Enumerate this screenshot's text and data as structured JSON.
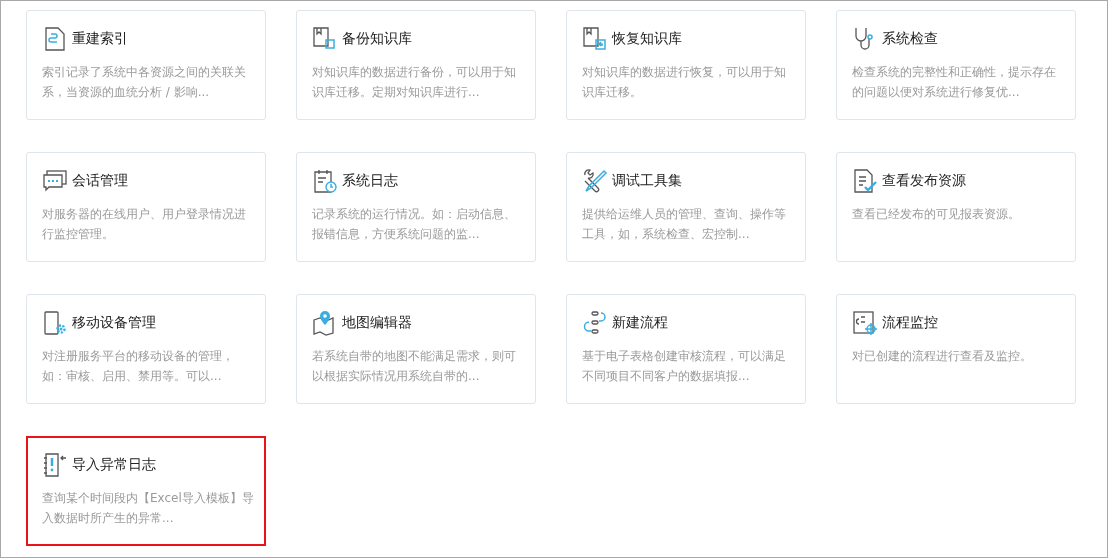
{
  "cards": [
    {
      "title": "重建索引",
      "description": "索引记录了系统中各资源之间的关联关系，当资源的血统分析 / 影响...",
      "selected": false
    },
    {
      "title": "备份知识库",
      "description": "对知识库的数据进行备份，可以用于知识库迁移。定期对知识库进行...",
      "selected": false
    },
    {
      "title": "恢复知识库",
      "description": "对知识库的数据进行恢复，可以用于知识库迁移。",
      "selected": false
    },
    {
      "title": "系统检查",
      "description": "检查系统的完整性和正确性，提示存在的问题以便对系统进行修复优...",
      "selected": false
    },
    {
      "title": "会话管理",
      "description": "对服务器的在线用户、用户登录情况进行监控管理。",
      "selected": false
    },
    {
      "title": "系统日志",
      "description": "记录系统的运行情况。如：启动信息、报错信息，方便系统问题的监...",
      "selected": false
    },
    {
      "title": "调试工具集",
      "description": "提供给运维人员的管理、查询、操作等工具，如，系统检查、宏控制...",
      "selected": false
    },
    {
      "title": "查看发布资源",
      "description": "查看已经发布的可见报表资源。",
      "selected": false
    },
    {
      "title": "移动设备管理",
      "description": "对注册服务平台的移动设备的管理，如：审核、启用、禁用等。可以...",
      "selected": false
    },
    {
      "title": "地图编辑器",
      "description": "若系统自带的地图不能满足需求，则可以根据实际情况用系统自带的...",
      "selected": false
    },
    {
      "title": "新建流程",
      "description": "基于电子表格创建审核流程，可以满足不同项目不同客户的数据填报...",
      "selected": false
    },
    {
      "title": "流程监控",
      "description": "对已创建的流程进行查看及监控。",
      "selected": false
    },
    {
      "title": "导入异常日志",
      "description": "查询某个时间段内【Excel导入模板】导入数据时所产生的异常...",
      "selected": true
    }
  ]
}
